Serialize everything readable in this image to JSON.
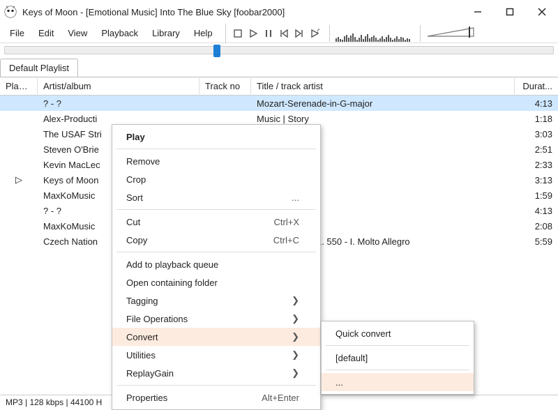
{
  "window": {
    "title": "Keys of Moon - [Emotional Music] Into The Blue Sky  [foobar2000]"
  },
  "menubar": {
    "file": "File",
    "edit": "Edit",
    "view": "View",
    "playback": "Playback",
    "library": "Library",
    "help": "Help"
  },
  "seek": {
    "percent": 38
  },
  "tabs": {
    "default": "Default Playlist"
  },
  "columns": {
    "playing": "Playi...",
    "artist": "Artist/album",
    "trackno": "Track no",
    "title": "Title / track artist",
    "duration": "Durat..."
  },
  "rows": [
    {
      "playing": "",
      "artist": "? - ?",
      "trackno": "",
      "title": "Mozart-Serenade-in-G-major",
      "dur": "4:13",
      "selected": true
    },
    {
      "playing": "",
      "artist": "Alex-Producti",
      "trackno": "",
      "title": "Music | Story",
      "dur": "1:18"
    },
    {
      "playing": "",
      "artist": "The USAF Stri",
      "trackno": "",
      "title": "",
      "dur": "3:03"
    },
    {
      "playing": "",
      "artist": "Steven O'Brie",
      "trackno": "",
      "title": "1",
      "dur": "2:51"
    },
    {
      "playing": "",
      "artist": "Kevin MacLec",
      "trackno": "",
      "title": "ntain King",
      "dur": "2:33"
    },
    {
      "playing": "▷",
      "artist": "Keys of Moon",
      "trackno": "",
      "title": "y",
      "dur": "3:13"
    },
    {
      "playing": "",
      "artist": "MaxKoMusic",
      "trackno": "",
      "title": "",
      "dur": "1:59"
    },
    {
      "playing": "",
      "artist": "? - ?",
      "trackno": "",
      "title": "e-in-G-major",
      "dur": "4:13"
    },
    {
      "playing": "",
      "artist": "MaxKoMusic",
      "trackno": "",
      "title": "",
      "dur": "2:08"
    },
    {
      "playing": "",
      "artist": "Czech Nation",
      "trackno": "",
      "title": "40 in G Minor, K. 550 - I. Molto Allegro",
      "dur": "5:59"
    }
  ],
  "context_menu": {
    "play": "Play",
    "remove": "Remove",
    "crop": "Crop",
    "sort": "Sort",
    "sort_ellipsis": "...",
    "cut": "Cut",
    "cut_k": "Ctrl+X",
    "copy": "Copy",
    "copy_k": "Ctrl+C",
    "add_queue": "Add to playback queue",
    "open_folder": "Open containing folder",
    "tagging": "Tagging",
    "file_ops": "File Operations",
    "convert": "Convert",
    "utilities": "Utilities",
    "replaygain": "ReplayGain",
    "properties": "Properties",
    "properties_k": "Alt+Enter"
  },
  "submenu": {
    "quick": "Quick convert",
    "default": "[default]",
    "more": "..."
  },
  "status": "MP3 | 128 kbps | 44100 H",
  "spectrum_bars": [
    5,
    7,
    4,
    3,
    8,
    10,
    6,
    9,
    12,
    7,
    3,
    6,
    10,
    4,
    8,
    11,
    5,
    7,
    9,
    6,
    3,
    5,
    8,
    4,
    7,
    10,
    6,
    3,
    5,
    8,
    4,
    7,
    6,
    3,
    5,
    4
  ]
}
